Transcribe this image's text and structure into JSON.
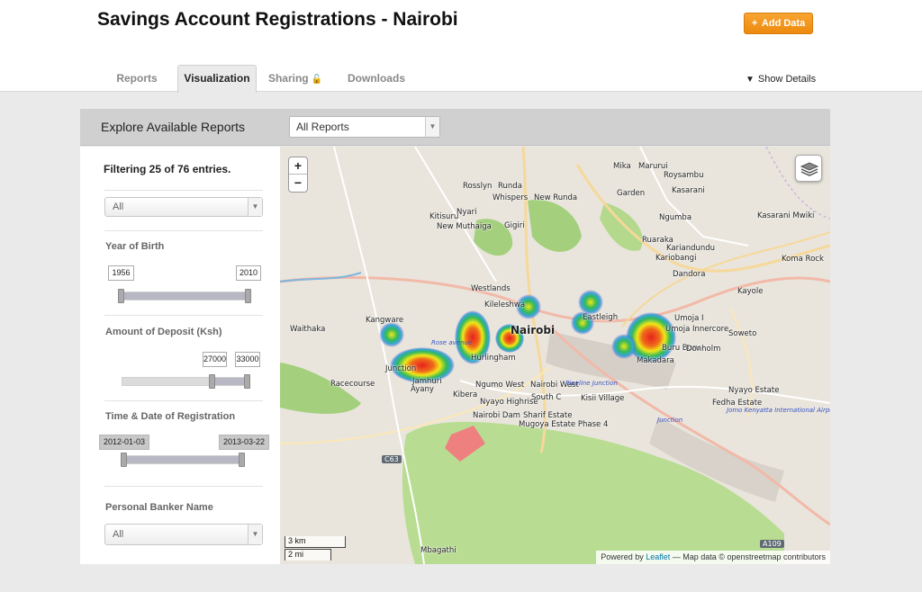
{
  "header": {
    "title": "Savings Account Registrations - Nairobi",
    "add_button": "Add Data",
    "show_details": "Show Details"
  },
  "tabs": [
    {
      "label": "Reports"
    },
    {
      "label": "Visualization",
      "active": true
    },
    {
      "label": "Sharing"
    },
    {
      "label": "Downloads"
    }
  ],
  "explore": {
    "title": "Explore Available Reports",
    "select_value": "All Reports"
  },
  "sidebar": {
    "filter_count": "Filtering 25 of 76 entries.",
    "top_select": "All",
    "year_of_birth": {
      "label": "Year of Birth",
      "min": "1956",
      "max": "2010"
    },
    "deposit": {
      "label": "Amount of Deposit (Ksh)",
      "min": "27000",
      "max": "33000"
    },
    "registration": {
      "label": "Time & Date of Registration",
      "start": "2012-01-03",
      "end": "2013-03-22"
    },
    "banker": {
      "label": "Personal Banker Name",
      "value": "All"
    }
  },
  "map": {
    "zoom_in": "+",
    "zoom_out": "−",
    "scale_km": "3 km",
    "scale_mi": "2 mi",
    "attribution_prefix": "Powered by ",
    "attribution_link": "Leaflet",
    "attribution_suffix": " — Map data © openstreetmap contributors",
    "places": [
      "Mika",
      "Marurui",
      "Roysambu",
      "Rosslyn",
      "Runda",
      "Whispers",
      "New Runda",
      "Garden",
      "Kasarani",
      "Nyari",
      "Kitisuru",
      "New Muthaiga",
      "Gigiri",
      "Ngumba",
      "Kasarani Mwiki",
      "Ruaraka",
      "Kariandundu",
      "Kariobangi",
      "Koma Rock",
      "Dandora",
      "Westlands",
      "Kayole",
      "Kileleshwa",
      "Eastleigh",
      "Kangware",
      "Nairobi",
      "Umoja I",
      "Umoja Innercore",
      "Waithaka",
      "Buru Buru",
      "Donholm",
      "Soweto",
      "Makadara",
      "Junction",
      "Hurlingham",
      "Racecourse",
      "Jamhuri",
      "Ayany",
      "Ngumo West",
      "Nairobi West",
      "Kibera",
      "Nyayo Highrise",
      "South C",
      "Kisii Village",
      "Nyayo Estate",
      "Fedha Estate",
      "Nairobi Dam",
      "Sharif Estate",
      "Mugoya Estate Phase 4",
      "Mbagathi",
      "Pipeline Junction",
      "Junction",
      "Jomo Kenyatta International Airport",
      "Rose avenue",
      "C63",
      "A109"
    ]
  },
  "colors": {
    "accent": "#f39a1e",
    "heat_hot": "#e8211f",
    "heat_warm": "#f0e817",
    "heat_cool": "#35a6d6",
    "heat_edge": "#5a4fd6"
  }
}
